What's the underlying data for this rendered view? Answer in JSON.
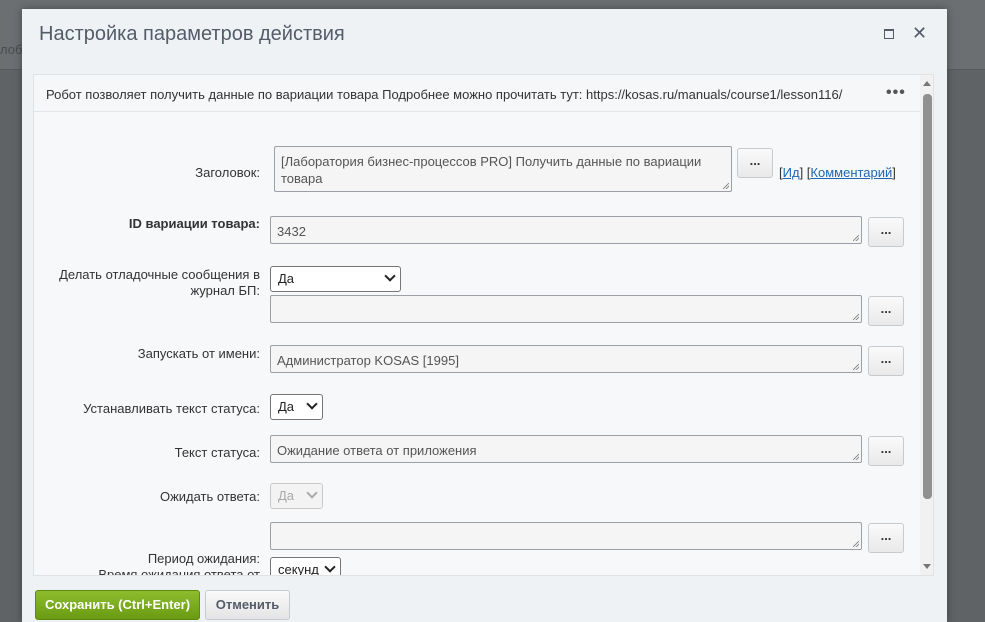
{
  "background": {
    "fragment": "лоб"
  },
  "dialog": {
    "title": "Настройка параметров действия",
    "description": "Робот позволяет получить данные по вариации товара Подробнее можно прочитать тут: https://kosas.ru/manuals/course1/lesson116/",
    "more_icon": "•••",
    "close_icon": "✕"
  },
  "form": {
    "title_label": "Заголовок:",
    "title_value": "[Лаборатория бизнес-процессов PRO] Получить данные по вариации товара",
    "link_open": "[",
    "link_id": "Ид",
    "link_sep": "]   [",
    "link_comment": "Комментарий",
    "link_close": "]",
    "variation_label": "ID вариации товара:",
    "variation_value": "3432",
    "debug_label": "Делать отладочные сообщения в журнал БП:",
    "debug_select": "Да",
    "debug_text": "",
    "run_as_label": "Запускать от имени:",
    "run_as_value": "Администратор KOSAS [1995]",
    "set_status_label": "Устанавливать текст статуса:",
    "set_status_select": "Да",
    "status_text_label": "Текст статуса:",
    "status_text_value": "Ожидание ответа от приложения",
    "wait_label": "Ожидать ответа:",
    "wait_select": "Да",
    "wait_text": "",
    "period_label": "Период ожидания:",
    "timeout_label": "Время ожидания ответа от",
    "period_select": "секунд",
    "dots_label": "..."
  },
  "footer": {
    "save_label": "Сохранить (Ctrl+Enter)",
    "cancel_label": "Отменить"
  },
  "colors": {
    "save_button": "#7aa81c",
    "link": "#2067b0",
    "title_text": "#535c69"
  }
}
